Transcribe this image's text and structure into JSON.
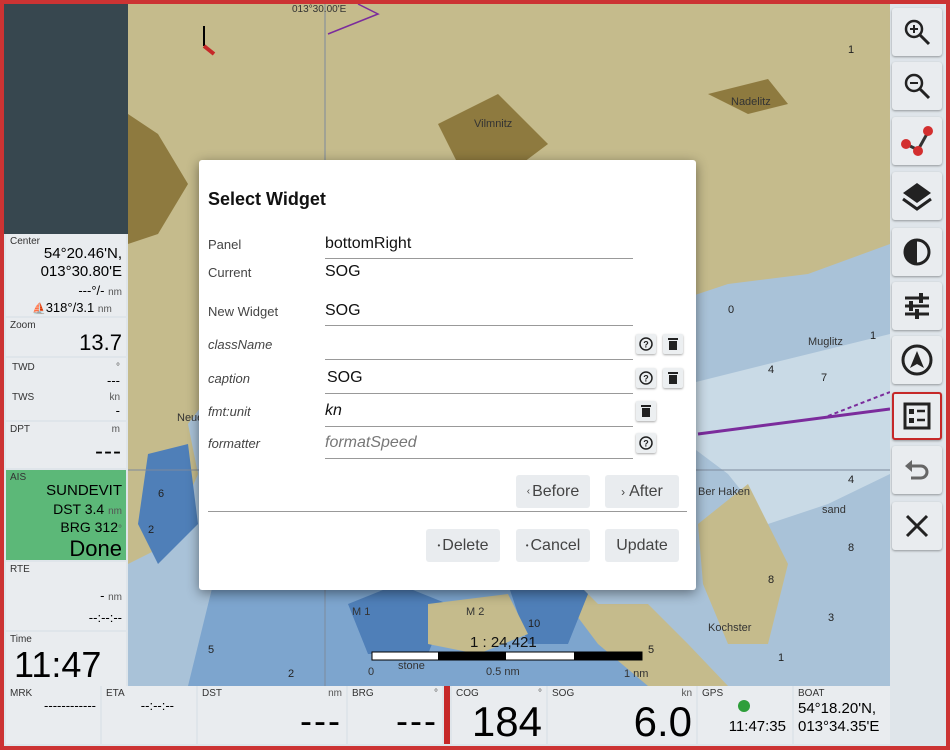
{
  "map": {
    "lon_label": "013°30.00'E",
    "places": [
      "Vilmnitz",
      "Nadelitz",
      "Muglitz",
      "Neue",
      "Ber Haken",
      "sand",
      "stone",
      "Kochster",
      "M 1",
      "M 2"
    ],
    "scale_text": "1 : 24,421",
    "scale_0": "0",
    "scale_half": "0.5 nm",
    "scale_one": "1 nm",
    "depths": [
      "1",
      "7",
      "4",
      "8",
      "3",
      "6",
      "2",
      "5",
      "10",
      "1",
      "0",
      "4",
      "5",
      "2",
      "8",
      "1"
    ]
  },
  "left": {
    "center": {
      "label": "Center",
      "lat": "54°20.46'N,",
      "lon": "013°30.80'E",
      "dist": "---°/-",
      "dist_unit": "nm",
      "brg": "318°/3.1",
      "brg_unit": "nm"
    },
    "zoom": {
      "label": "Zoom",
      "value": "13.7"
    },
    "twd": {
      "label": "TWD",
      "unit": "°",
      "value": "---"
    },
    "tws": {
      "label": "TWS",
      "unit": "kn",
      "value": "-"
    },
    "dpt": {
      "label": "DPT",
      "unit": "m",
      "value": "---"
    },
    "ais": {
      "label": "AIS",
      "name": "SUNDEVIT",
      "dst_label": "DST",
      "dst": "3.4",
      "dst_unit": "nm",
      "brg_label": "BRG",
      "brg": "312",
      "brg_unit": "°",
      "status": "Done"
    },
    "rte": {
      "label": "RTE",
      "value": "-",
      "unit": "nm",
      "eta": "--:--:--"
    },
    "time": {
      "label": "Time",
      "value": "11:47"
    }
  },
  "bottom": {
    "mrk": {
      "label": "MRK",
      "value": "------------"
    },
    "eta": {
      "label": "ETA",
      "value": "--:--:--"
    },
    "dst": {
      "label": "DST",
      "unit": "nm",
      "value": "---"
    },
    "brg": {
      "label": "BRG",
      "unit": "°",
      "value": "---"
    },
    "cog": {
      "label": "COG",
      "unit": "°",
      "value": "184"
    },
    "sog": {
      "label": "SOG",
      "unit": "kn",
      "value": "6.0"
    },
    "gps": {
      "label": "GPS",
      "time": "11:47:35"
    },
    "boat": {
      "label": "BOAT",
      "lat": "54°18.20'N,",
      "lon": "013°34.35'E"
    }
  },
  "toolbar": [
    "zoom-in-icon",
    "zoom-out-icon",
    "route-icon",
    "layers-icon",
    "contrast-icon",
    "settings-sliders-icon",
    "navigation-icon",
    "widget-editor-icon",
    "undo-icon",
    "close-icon"
  ],
  "dialog": {
    "title": "Select Widget",
    "panel_label": "Panel",
    "panel_value": "bottomRight",
    "current_label": "Current",
    "current_value": "SOG",
    "new_widget_label": "New Widget",
    "new_widget_value": "SOG",
    "classname_label": "className",
    "classname_value": "",
    "caption_label": "caption",
    "caption_value": "SOG",
    "fmtunit_label": "fmt:unit",
    "fmtunit_value": "kn",
    "formatter_label": "formatter",
    "formatter_placeholder": "formatSpeed",
    "before_label": "Before",
    "after_label": "After",
    "delete_label": "Delete",
    "cancel_label": "Cancel",
    "update_label": "Update"
  }
}
